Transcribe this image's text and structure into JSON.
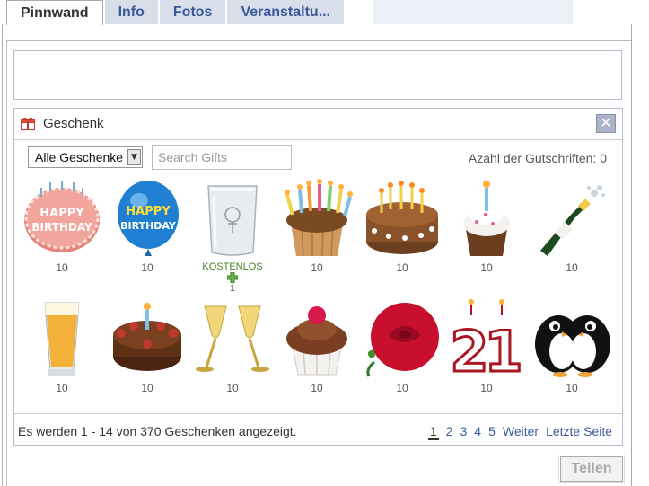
{
  "tabs": [
    {
      "label": "Pinnwand",
      "active": true
    },
    {
      "label": "Info",
      "active": false
    },
    {
      "label": "Fotos",
      "active": false
    },
    {
      "label": "Veranstaltu...",
      "active": false
    }
  ],
  "gift_panel": {
    "title": "Geschenk",
    "close_icon": "close-icon",
    "filter": {
      "selected": "Alle Geschenke"
    },
    "search": {
      "placeholder": "Search Gifts",
      "value": ""
    },
    "credits_label": "Azahl der Gutschriften: 0",
    "gifts": [
      {
        "icon": "birthday-cake-icon",
        "price": "10"
      },
      {
        "icon": "birthday-balloon-icon",
        "price": "10"
      },
      {
        "icon": "glass-tumbler-icon",
        "price": "KOSTENLOS",
        "bonus": "1",
        "free": true
      },
      {
        "icon": "candle-cupcake-icon",
        "price": "10"
      },
      {
        "icon": "chocolate-cake-icon",
        "price": "10"
      },
      {
        "icon": "cupcake-candle-icon",
        "price": "10"
      },
      {
        "icon": "champagne-bottle-icon",
        "price": "10"
      },
      {
        "icon": "beer-glass-icon",
        "price": "10"
      },
      {
        "icon": "chocolate-torte-icon",
        "price": "10"
      },
      {
        "icon": "champagne-glasses-icon",
        "price": "10"
      },
      {
        "icon": "raspberry-cupcake-icon",
        "price": "10"
      },
      {
        "icon": "red-rose-icon",
        "price": "10"
      },
      {
        "icon": "number-21-candles-icon",
        "price": "10"
      },
      {
        "icon": "penguins-icon",
        "price": "10"
      }
    ],
    "footer": {
      "summary": "Es werden 1 - 14 von 370 Geschenken angezeigt.",
      "pages": [
        "1",
        "2",
        "3",
        "4",
        "5"
      ],
      "current_page": "1",
      "next_label": "Weiter",
      "last_label": "Letzte Seite"
    }
  },
  "share_button": {
    "label": "Teilen",
    "enabled": false
  }
}
